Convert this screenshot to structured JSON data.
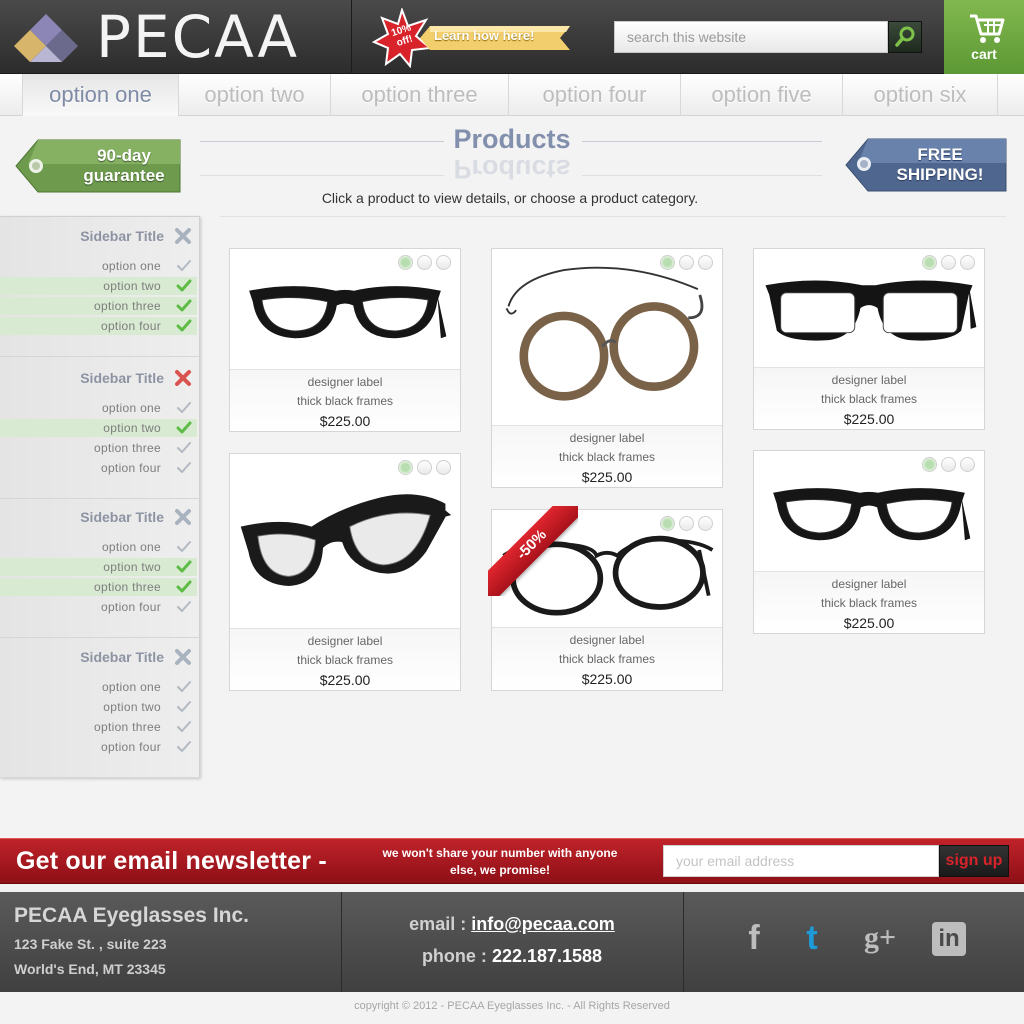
{
  "brand": {
    "name": "PECAA"
  },
  "promo": {
    "star_text": "10% off!",
    "label": "Learn how here!"
  },
  "search": {
    "placeholder": "search this website"
  },
  "cart": {
    "label": "cart"
  },
  "nav": {
    "items": [
      "option one",
      "option two",
      "option three",
      "option four",
      "option five",
      "option six"
    ],
    "active": "option one"
  },
  "badges": {
    "left": "90-day guarantee",
    "right": "FREE SHIPPING!"
  },
  "main": {
    "title": "Products",
    "subtitle": "Click a product to view details, or choose a product category."
  },
  "sidebar": {
    "sections": [
      {
        "title": "Sidebar Title",
        "close_state": "gray",
        "items": [
          {
            "label": "option one",
            "checked": false
          },
          {
            "label": "option two",
            "checked": true
          },
          {
            "label": "option three",
            "checked": true
          },
          {
            "label": "option four",
            "checked": true
          }
        ]
      },
      {
        "title": "Sidebar Title",
        "close_state": "red",
        "items": [
          {
            "label": "option one",
            "checked": false
          },
          {
            "label": "option two",
            "checked": true
          },
          {
            "label": "option three",
            "checked": false
          },
          {
            "label": "option four",
            "checked": false
          }
        ]
      },
      {
        "title": "Sidebar Title",
        "close_state": "gray",
        "items": [
          {
            "label": "option one",
            "checked": false
          },
          {
            "label": "option two",
            "checked": true
          },
          {
            "label": "option three",
            "checked": true
          },
          {
            "label": "option four",
            "checked": false
          }
        ]
      },
      {
        "title": "Sidebar Title",
        "close_state": "gray",
        "items": [
          {
            "label": "option one",
            "checked": false
          },
          {
            "label": "option two",
            "checked": false
          },
          {
            "label": "option three",
            "checked": false
          },
          {
            "label": "option four",
            "checked": false
          }
        ]
      }
    ]
  },
  "products": [
    {
      "label": "designer label",
      "description": "thick black frames",
      "price": "$225.00",
      "style": "wayfarer",
      "sale": ""
    },
    {
      "label": "designer label",
      "description": "thick black frames",
      "price": "$225.00",
      "style": "round-wire",
      "sale": ""
    },
    {
      "label": "designer label",
      "description": "thick black frames",
      "price": "$225.00",
      "style": "rectangular",
      "sale": ""
    },
    {
      "label": "designer label",
      "description": "thick black frames",
      "price": "$225.00",
      "style": "wayfarer-angled",
      "sale": ""
    },
    {
      "label": "designer label",
      "description": "thick black frames",
      "price": "$225.00",
      "style": "round-thin",
      "sale": "-50%"
    },
    {
      "label": "designer label",
      "description": "thick black frames",
      "price": "$225.00",
      "style": "wayfarer",
      "sale": ""
    }
  ],
  "newsletter": {
    "title": "Get our email newsletter -",
    "note": "we won't share your number with anyone else, we promise!",
    "placeholder": "your email address",
    "button": "sign up"
  },
  "footer": {
    "company": "PECAA Eyeglasses Inc.",
    "address_line1": "123 Fake St. , suite 223",
    "address_line2": "World's End, MT 23345",
    "email_label": "email :",
    "email": "info@pecaa.com",
    "phone_label": "phone :",
    "phone": "222.187.1588",
    "social": [
      {
        "name": "facebook-icon",
        "glyph": "f",
        "color": "#bdbdbd"
      },
      {
        "name": "twitter-icon",
        "glyph": "t",
        "color": "#1f9ad8"
      },
      {
        "name": "google-plus-icon",
        "glyph": "g+",
        "color": "#bdbdbd"
      },
      {
        "name": "linkedin-icon",
        "glyph": "in",
        "color": "#bdbdbd"
      }
    ],
    "copyright": "copyright © 2012 - PECAA Eyeglasses Inc. - All Rights Reserved"
  },
  "colors": {
    "brand_green": "#6aa63f",
    "nav_active": "#7f8ba6",
    "newsletter_red": "#b01b22",
    "check_green": "#5dbb46",
    "close_red": "#d9534f"
  }
}
